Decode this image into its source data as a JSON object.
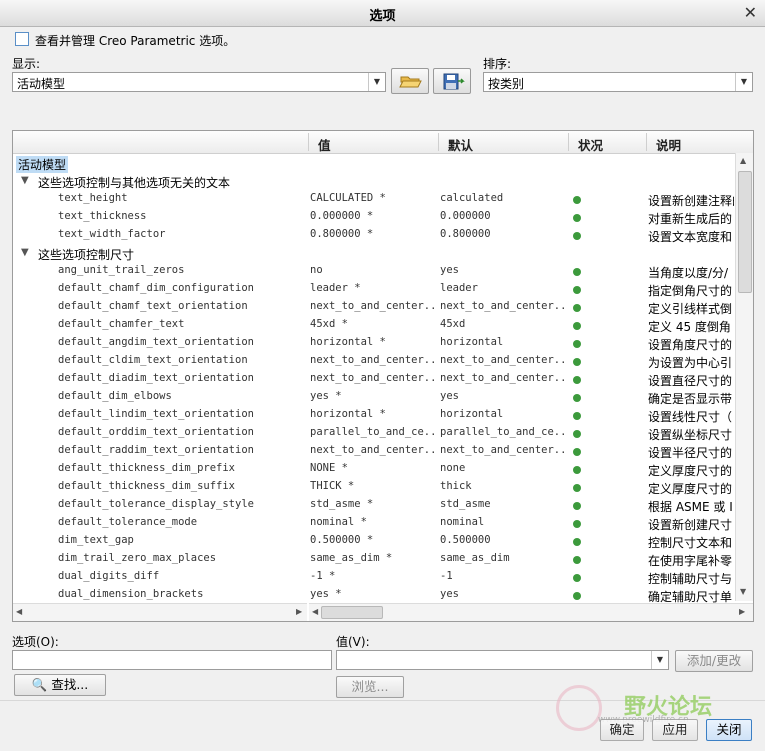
{
  "window": {
    "title": "选项"
  },
  "manage_checkbox": {
    "label": "查看并管理 Creo Parametric 选项。"
  },
  "display": {
    "label": "显示:",
    "value": "活动模型"
  },
  "sort": {
    "label": "排序:",
    "value": "按类别"
  },
  "columns": {
    "value": "值",
    "default": "默认",
    "status": "状况",
    "description": "说明"
  },
  "tree": {
    "root": "活动模型",
    "groups": [
      {
        "label": "这些选项控制与其他选项无关的文本",
        "rows": [
          {
            "name": "text_height",
            "value": "CALCULATED *",
            "default": "calculated",
            "desc": "设置新创建注释的"
          },
          {
            "name": "text_thickness",
            "value": "0.000000 *",
            "default": "0.000000",
            "desc": "对重新生成后的"
          },
          {
            "name": "text_width_factor",
            "value": "0.800000 *",
            "default": "0.800000",
            "desc": "设置文本宽度和"
          }
        ]
      },
      {
        "label": "这些选项控制尺寸",
        "rows": [
          {
            "name": "ang_unit_trail_zeros",
            "value": "no",
            "default": "yes",
            "desc": "当角度以度/分/"
          },
          {
            "name": "default_chamf_dim_configuration",
            "value": "leader *",
            "default": "leader",
            "desc": "指定倒角尺寸的"
          },
          {
            "name": "default_chamf_text_orientation",
            "value": "next_to_and_center...",
            "default": "next_to_and_center...",
            "desc": "定义引线样式倒"
          },
          {
            "name": "default_chamfer_text",
            "value": "45xd *",
            "default": "45xd",
            "desc": "定义 45 度倒角"
          },
          {
            "name": "default_angdim_text_orientation",
            "value": "horizontal *",
            "default": "horizontal",
            "desc": "设置角度尺寸的"
          },
          {
            "name": "default_cldim_text_orientation",
            "value": "next_to_and_center...",
            "default": "next_to_and_center...",
            "desc": "为设置为中心引"
          },
          {
            "name": "default_diadim_text_orientation",
            "value": "next_to_and_center...",
            "default": "next_to_and_center...",
            "desc": "设置直径尺寸的"
          },
          {
            "name": "default_dim_elbows",
            "value": "yes *",
            "default": "yes",
            "desc": "确定是否显示带"
          },
          {
            "name": "default_lindim_text_orientation",
            "value": "horizontal *",
            "default": "horizontal",
            "desc": "设置线性尺寸（"
          },
          {
            "name": "default_orddim_text_orientation",
            "value": "parallel_to_and_ce...",
            "default": "parallel_to_and_ce...",
            "desc": "设置纵坐标尺寸"
          },
          {
            "name": "default_raddim_text_orientation",
            "value": "next_to_and_center...",
            "default": "next_to_and_center...",
            "desc": "设置半径尺寸的"
          },
          {
            "name": "default_thickness_dim_prefix",
            "value": "NONE *",
            "default": "none",
            "desc": "定义厚度尺寸的"
          },
          {
            "name": "default_thickness_dim_suffix",
            "value": "THICK *",
            "default": "thick",
            "desc": "定义厚度尺寸的"
          },
          {
            "name": "default_tolerance_display_style",
            "value": "std_asme *",
            "default": "std_asme",
            "desc": "根据 ASME 或 I"
          },
          {
            "name": "default_tolerance_mode",
            "value": "nominal *",
            "default": "nominal",
            "desc": "设置新创建尺寸"
          },
          {
            "name": "dim_text_gap",
            "value": "0.500000 *",
            "default": "0.500000",
            "desc": "控制尺寸文本和"
          },
          {
            "name": "dim_trail_zero_max_places",
            "value": "same_as_dim *",
            "default": "same_as_dim",
            "desc": "在使用字尾补零"
          },
          {
            "name": "dual_digits_diff",
            "value": "-1 *",
            "default": "-1",
            "desc": "控制辅助尺寸与"
          },
          {
            "name": "dual_dimension_brackets",
            "value": "yes *",
            "default": "yes",
            "desc": "确定辅助尺寸单"
          }
        ]
      }
    ],
    "status_color": "#3c9a3c"
  },
  "option_field": {
    "label": "选项(O):",
    "value": ""
  },
  "value_field": {
    "label": "值(V):",
    "value": ""
  },
  "buttons": {
    "add_change": "添加/更改",
    "find": "查找...",
    "browse": "浏览...",
    "ok": "确定",
    "apply": "应用",
    "close": "关闭"
  },
  "watermark": {
    "text": "野火论坛",
    "url": "www.proewildfire.cn"
  }
}
